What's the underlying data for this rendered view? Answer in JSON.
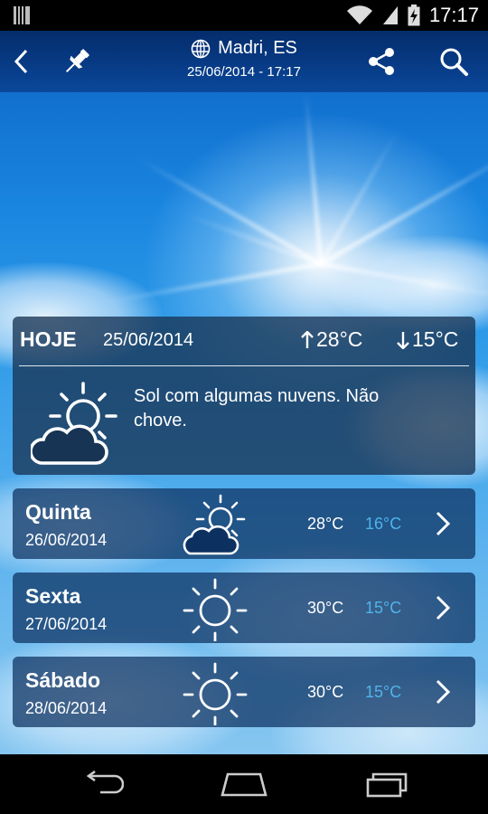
{
  "status_bar": {
    "time": "17:17"
  },
  "header": {
    "location": "Madri, ES",
    "datetime": "25/06/2014 - 17:17"
  },
  "today": {
    "label": "HOJE",
    "date": "25/06/2014",
    "max": "28°C",
    "min": "15°C",
    "description": "Sol com algumas nuvens. Não chove.",
    "icon": "partly-cloudy-icon"
  },
  "forecast": [
    {
      "day": "Quinta",
      "date": "26/06/2014",
      "max": "28°C",
      "min": "16°C",
      "icon": "partly-cloudy-icon"
    },
    {
      "day": "Sexta",
      "date": "27/06/2014",
      "max": "30°C",
      "min": "15°C",
      "icon": "sun-icon"
    },
    {
      "day": "Sábado",
      "date": "28/06/2014",
      "max": "30°C",
      "min": "15°C",
      "icon": "sun-icon"
    }
  ],
  "colors": {
    "min_temp": "#4fb4ea",
    "card_bg": "#0c3060",
    "action_bar": "#08306e"
  }
}
